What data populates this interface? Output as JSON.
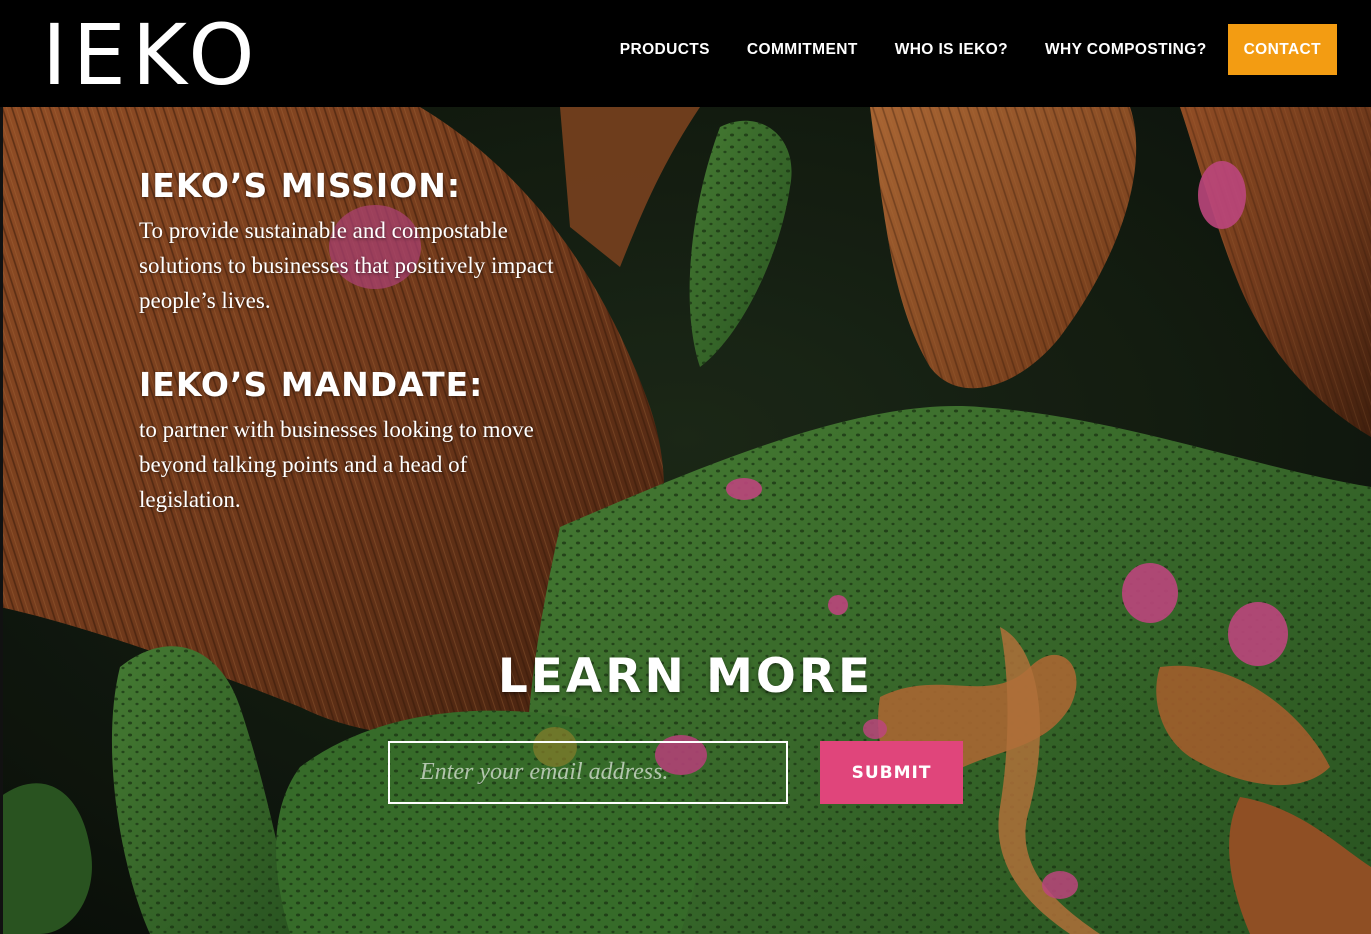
{
  "header": {
    "logo_text": "IEKO",
    "nav": {
      "products": "PRODUCTS",
      "commitment": "COMMITMENT",
      "who_is_ieko": "WHO IS IEKO?",
      "why_composting": "WHY COMPOSTING?",
      "contact": "CONTACT"
    }
  },
  "hero": {
    "mission": {
      "heading": "IEKO’S MISSION:",
      "text": "To provide sustainable and compostable solutions to businesses that positively impact people’s lives."
    },
    "mandate": {
      "heading": "IEKO’S MANDATE:",
      "text": "to partner with businesses looking to move beyond talking points and a head of legislation."
    },
    "learn_more": {
      "heading": "LEARN MORE",
      "email_placeholder": "Enter your email address.",
      "submit_label": "SUBMIT"
    }
  },
  "colors": {
    "header_bg": "#000000",
    "contact_button": "#f39c12",
    "submit_button": "#e0457b",
    "hero_orange_brown": "#8e4a22",
    "hero_green": "#3f7a30",
    "hero_pink": "#d64d8a"
  }
}
